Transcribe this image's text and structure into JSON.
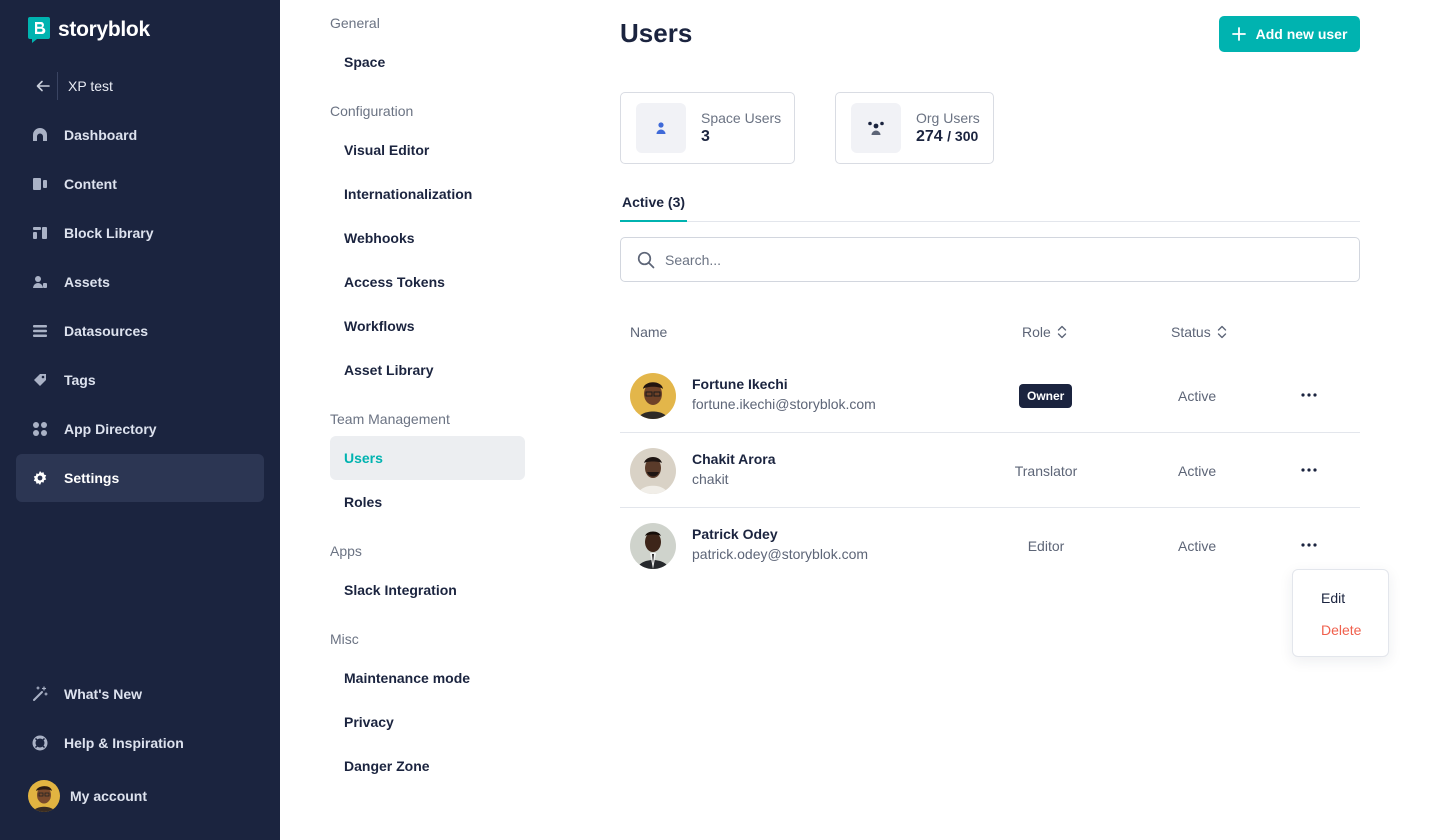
{
  "brand": {
    "name": "storyblok",
    "accent": "#00b3b0",
    "sidebar_bg": "#1b243f"
  },
  "sidebar": {
    "space_name": "XP test",
    "items": [
      {
        "label": "Dashboard",
        "icon": "dashboard-icon"
      },
      {
        "label": "Content",
        "icon": "content-icon"
      },
      {
        "label": "Block Library",
        "icon": "block-library-icon"
      },
      {
        "label": "Assets",
        "icon": "assets-icon"
      },
      {
        "label": "Datasources",
        "icon": "datasources-icon"
      },
      {
        "label": "Tags",
        "icon": "tags-icon"
      },
      {
        "label": "App Directory",
        "icon": "app-directory-icon"
      },
      {
        "label": "Settings",
        "icon": "gear-icon",
        "active": true
      }
    ],
    "bottom": [
      {
        "label": "What's New",
        "icon": "magic-wand-icon"
      },
      {
        "label": "Help & Inspiration",
        "icon": "lifebuoy-icon"
      }
    ],
    "account_label": "My account"
  },
  "settings_menu": {
    "sections": [
      {
        "heading": "General",
        "items": [
          "Space"
        ]
      },
      {
        "heading": "Configuration",
        "items": [
          "Visual Editor",
          "Internationalization",
          "Webhooks",
          "Access Tokens",
          "Workflows",
          "Asset Library"
        ]
      },
      {
        "heading": "Team Management",
        "items": [
          "Users",
          "Roles"
        ]
      },
      {
        "heading": "Apps",
        "items": [
          "Slack Integration"
        ]
      },
      {
        "heading": "Misc",
        "items": [
          "Maintenance mode",
          "Privacy",
          "Danger Zone"
        ]
      }
    ],
    "active_item": "Users"
  },
  "main": {
    "title": "Users",
    "add_button_label": "Add new user",
    "stats": {
      "space_users": {
        "label": "Space Users",
        "value": "3"
      },
      "org_users": {
        "label": "Org Users",
        "value": "274",
        "limit": "/ 300"
      }
    },
    "tab_label": "Active (3)",
    "search_placeholder": "Search...",
    "columns": {
      "name": "Name",
      "role": "Role",
      "status": "Status"
    },
    "users": [
      {
        "name": "Fortune Ikechi",
        "email": "fortune.ikechi@storyblok.com",
        "role": "Owner",
        "status": "Active"
      },
      {
        "name": "Chakit Arora",
        "email": "chakit",
        "role": "Translator",
        "status": "Active"
      },
      {
        "name": "Patrick Odey",
        "email": "patrick.odey@storyblok.com",
        "role": "Editor",
        "status": "Active"
      }
    ],
    "row_menu": {
      "edit": "Edit",
      "delete": "Delete"
    }
  }
}
